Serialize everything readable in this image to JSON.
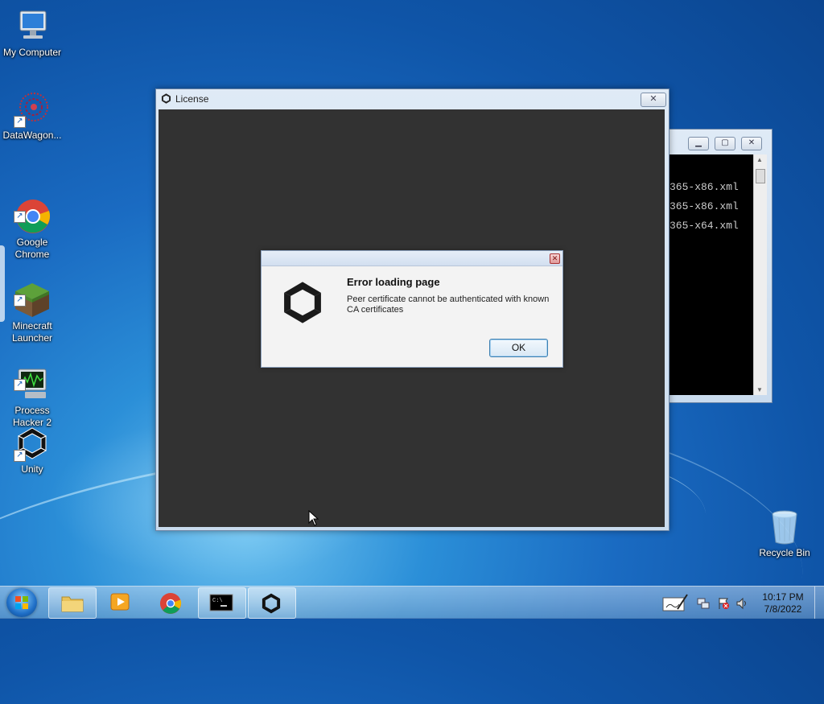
{
  "desktop": {
    "icons": [
      {
        "label": "My Computer"
      },
      {
        "label": "DataWagon..."
      },
      {
        "label": "Google\nChrome"
      },
      {
        "label": "Minecraft\nLauncher"
      },
      {
        "label": "Process\nHacker 2"
      },
      {
        "label": "Unity"
      },
      {
        "label": "Recycle Bin"
      }
    ]
  },
  "license_window": {
    "title": "License",
    "close_label": "✕"
  },
  "console_window": {
    "lines": [
      "365-x86.xml",
      "365-x86.xml",
      "365-x64.xml"
    ]
  },
  "error_dialog": {
    "heading": "Error loading page",
    "message": "Peer certificate cannot be authenticated with known CA certificates",
    "ok_label": "OK",
    "close_label": "✕"
  },
  "taskbar": {
    "clock_time": "10:17 PM",
    "clock_date": "7/8/2022"
  },
  "colors": {
    "license_content_bg": "#323232",
    "desktop_blue": "#1a6bc2"
  }
}
